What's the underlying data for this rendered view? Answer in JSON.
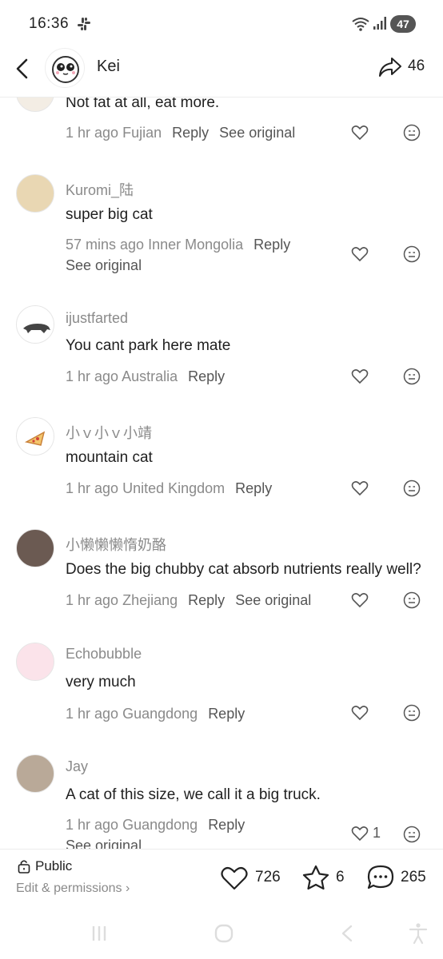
{
  "status": {
    "time": "16:36",
    "battery": "47"
  },
  "header": {
    "name": "Kei",
    "share_count": "46"
  },
  "comments": [
    {
      "text": "Not fat at all, eat more.",
      "time": "1 hr ago",
      "location": "Fujian",
      "reply": "Reply",
      "see_original": "See original"
    },
    {
      "username": "Kuromi_陆",
      "text": "super big cat",
      "time": "57 mins ago",
      "location": "Inner Mongolia",
      "reply": "Reply",
      "see_original": "See original"
    },
    {
      "username": "ijustfarted",
      "text": "You cant park here mate",
      "time": "1 hr ago",
      "location": "Australia",
      "reply": "Reply"
    },
    {
      "username": "小ｖ小ｖ小靖",
      "text": "mountain cat",
      "time": "1 hr ago",
      "location": "United Kingdom",
      "reply": "Reply"
    },
    {
      "username": "小懒懒懒惰奶酪",
      "text": "Does the big chubby cat absorb nutrients really well?",
      "time": "1 hr ago",
      "location": "Zhejiang",
      "reply": "Reply",
      "see_original": "See original"
    },
    {
      "username": "Echobubble",
      "text": "very much",
      "time": "1 hr ago",
      "location": "Guangdong",
      "reply": "Reply"
    },
    {
      "username": "Jay",
      "text": "A cat of this size, we call it a big truck.",
      "time": "1 hr ago",
      "location": "Guangdong",
      "reply": "Reply",
      "see_original": "See original",
      "likes": "1"
    }
  ],
  "bottom": {
    "visibility": "Public",
    "edit": "Edit & permissions ›",
    "likes": "726",
    "favorites": "6",
    "comments": "265"
  }
}
